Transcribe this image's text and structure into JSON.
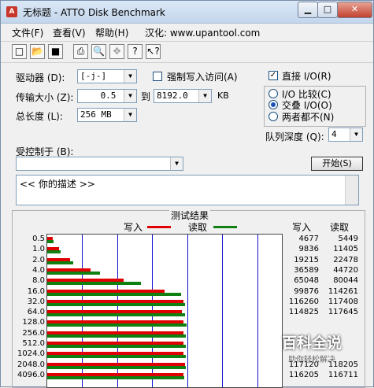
{
  "window": {
    "title": "无标题 - ATTO Disk Benchmark",
    "min_label": "▁",
    "max_label": "□",
    "close_label": "✕"
  },
  "menu": {
    "file": "文件(F)",
    "view": "查看(V)",
    "help": "帮助(H)",
    "localized": "汉化: www.upantool.com"
  },
  "toolbar": [
    "new-icon",
    "open-icon",
    "save-icon",
    "print-icon",
    "print-preview-icon",
    "move-icon",
    "help-icon",
    "context-help-icon"
  ],
  "form": {
    "drive_label": "驱动器 (D):",
    "drive_value": "[-j-]",
    "force_write_label": "强制写入访问(A)",
    "transfer_label": "传输大小 (Z):",
    "transfer_from": "0.5",
    "transfer_to_label": "到",
    "transfer_to": "8192.0",
    "transfer_unit": "KB",
    "length_label": "总长度 (L):",
    "length_value": "256 MB",
    "direct_io_label": "直接 I/O(R)",
    "io_compare_label": "I/O 比较(C)",
    "overlap_io_label": "交叠 I/O(O)",
    "neither_label": "两者都不(N)",
    "queue_label": "队列深度 (Q):",
    "queue_value": "4",
    "controlled_label": "受控制于 (B):",
    "start_button": "开始(S)",
    "description": "<<   你的描述    >>"
  },
  "results": {
    "title": "测试结果",
    "write_label": "写入",
    "read_label": "读取",
    "col_write": "写入",
    "col_read": "读取",
    "write_color": "#e00000",
    "read_color": "#108010"
  },
  "chart_data": {
    "type": "bar",
    "orientation": "horizontal",
    "title": "测试结果",
    "categories": [
      "0.5",
      "1.0",
      "2.0",
      "4.0",
      "8.0",
      "16.0",
      "32.0",
      "64.0",
      "128.0",
      "256.0",
      "512.0",
      "1024.0",
      "2048.0",
      "4096.0"
    ],
    "series": [
      {
        "name": "写入",
        "values": [
          4677,
          9836,
          19215,
          36589,
          65048,
          99876,
          116260,
          114825,
          116000,
          116000,
          116000,
          116000,
          117120,
          116205
        ]
      },
      {
        "name": "读取",
        "values": [
          5449,
          11405,
          22478,
          44720,
          80044,
          114261,
          117408,
          117645,
          119000,
          118000,
          118000,
          118000,
          118205,
          116711
        ]
      }
    ],
    "xlim": [
      0,
      200000
    ]
  },
  "table_rows": [
    {
      "size": "0.5",
      "write": "4677",
      "read": "5449"
    },
    {
      "size": "1.0",
      "write": "9836",
      "read": "11405"
    },
    {
      "size": "2.0",
      "write": "19215",
      "read": "22478"
    },
    {
      "size": "4.0",
      "write": "36589",
      "read": "44720"
    },
    {
      "size": "8.0",
      "write": "65048",
      "read": "80044"
    },
    {
      "size": "16.0",
      "write": "99876",
      "read": "114261"
    },
    {
      "size": "32.0",
      "write": "116260",
      "read": "117408"
    },
    {
      "size": "64.0",
      "write": "114825",
      "read": "117645"
    },
    {
      "size": "128.0",
      "write": "",
      "read": ""
    },
    {
      "size": "256.0",
      "write": "",
      "read": ""
    },
    {
      "size": "512.0",
      "write": "",
      "read": ""
    },
    {
      "size": "1024.0",
      "write": "",
      "read": ""
    },
    {
      "size": "2048.0",
      "write": "117120",
      "read": "118205"
    },
    {
      "size": "4096.0",
      "write": "116205",
      "read": "116711"
    }
  ],
  "watermark": {
    "main": "百科全说",
    "sub": "助你轻松解决"
  }
}
